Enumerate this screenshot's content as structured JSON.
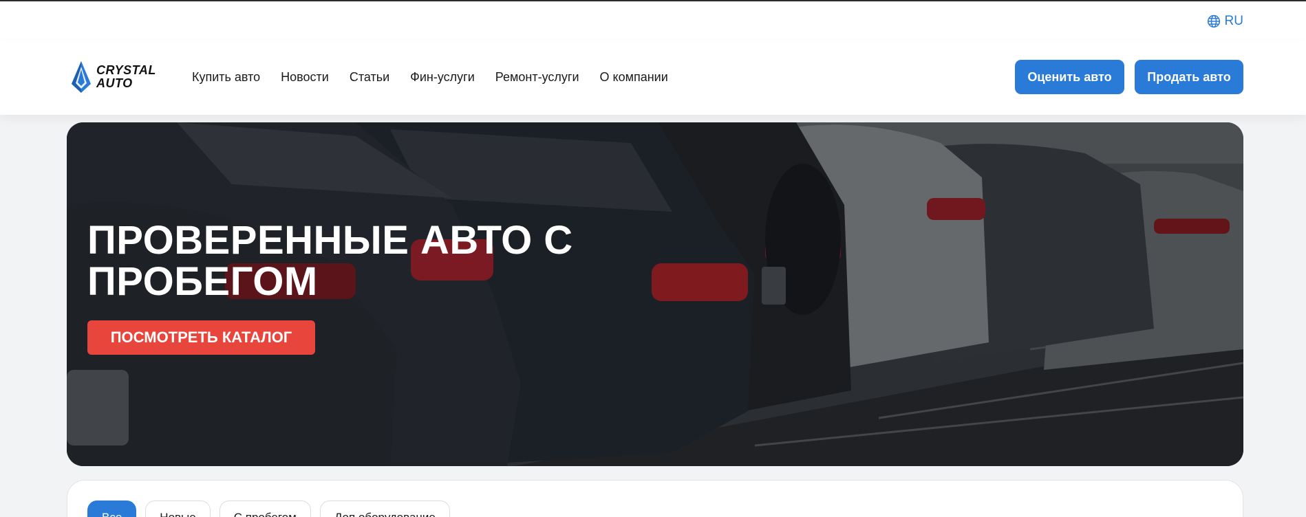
{
  "topbar": {
    "language": "RU",
    "language_icon": "globe-icon"
  },
  "header": {
    "logo": {
      "line1": "CRYSTAL",
      "line2": "AUTO",
      "icon": "crystal-logo-icon"
    },
    "nav": [
      {
        "label": "Купить авто"
      },
      {
        "label": "Новости"
      },
      {
        "label": "Статьи"
      },
      {
        "label": "Фин-услуги"
      },
      {
        "label": "Ремонт-услуги"
      },
      {
        "label": "О компании"
      }
    ],
    "estimate_label": "Оценить авто",
    "sell_label": "Продать авто"
  },
  "hero": {
    "title": "ПРОВЕРЕННЫЕ АВТО С ПРОБЕГОМ",
    "cta_label": "ПОСМОТРЕТЬ КАТАЛОГ",
    "background": "photo of parked cars"
  },
  "filters": {
    "chips": [
      {
        "label": "Все",
        "active": true
      },
      {
        "label": "Новые",
        "active": false
      },
      {
        "label": "С пробегом",
        "active": false
      },
      {
        "label": "Доп.оборудование",
        "active": false
      }
    ]
  },
  "colors": {
    "accent": "#2a7ad8",
    "cta": "#e8453c",
    "page_bg": "#f2f3f5"
  }
}
